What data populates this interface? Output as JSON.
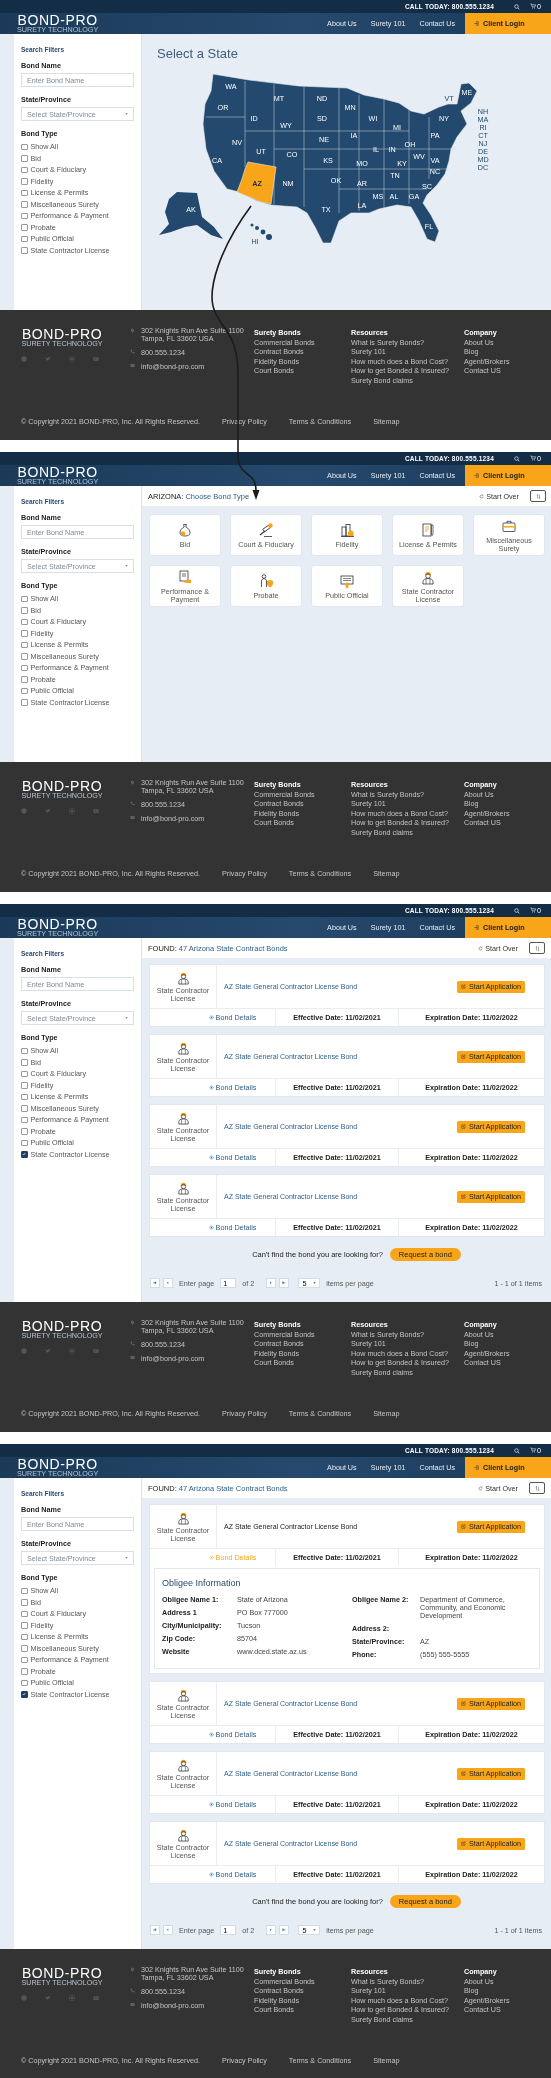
{
  "screens": [
    {
      "kind": "state_map",
      "header": {
        "phone": "CALL TODAY: 800.555.1234",
        "cart_count": "0",
        "logo": "BOND-PRO",
        "tagline": "SURETY TECHNOLOGY",
        "nav": [
          "About Us",
          "Surety 101",
          "Contact Us"
        ],
        "login": "Client Login"
      },
      "sidebar": {
        "title": "Search Filters",
        "bond_name": {
          "label": "Bond Name",
          "placeholder": "Enter Bond Name"
        },
        "state": {
          "label": "State/Province",
          "placeholder": "Select State/Province"
        },
        "bond_type": {
          "label": "Bond Type",
          "options": [
            {
              "label": "Show All",
              "checked": false
            },
            {
              "label": "Bid",
              "checked": false
            },
            {
              "label": "Court & Fiduciary",
              "checked": false
            },
            {
              "label": "Fidelity",
              "checked": false
            },
            {
              "label": "License & Permits",
              "checked": false
            },
            {
              "label": "Miscellaneous Surety",
              "checked": false
            },
            {
              "label": "Performance & Payment",
              "checked": false
            },
            {
              "label": "Probate",
              "checked": false
            },
            {
              "label": "Public Official",
              "checked": false
            },
            {
              "label": "State Contractor License",
              "checked": false
            }
          ]
        }
      },
      "main": {
        "title": "Select a State",
        "states": [
          {
            "abbr": "WA",
            "selected": false
          },
          {
            "abbr": "ME",
            "selected": false
          },
          {
            "abbr": "MT",
            "selected": false
          },
          {
            "abbr": "ND",
            "selected": false
          },
          {
            "abbr": "VT",
            "selected": false
          },
          {
            "abbr": "OR",
            "selected": false
          },
          {
            "abbr": "MN",
            "selected": false
          },
          {
            "abbr": "NH",
            "selected": false
          },
          {
            "abbr": "ID",
            "selected": false
          },
          {
            "abbr": "SD",
            "selected": false
          },
          {
            "abbr": "WI",
            "selected": false
          },
          {
            "abbr": "NY",
            "selected": false
          },
          {
            "abbr": "MA",
            "selected": false
          },
          {
            "abbr": "WY",
            "selected": false
          },
          {
            "abbr": "MI",
            "selected": false
          },
          {
            "abbr": "RI",
            "selected": false
          },
          {
            "abbr": "IA",
            "selected": false
          },
          {
            "abbr": "PA",
            "selected": false
          },
          {
            "abbr": "CT",
            "selected": false
          },
          {
            "abbr": "NE",
            "selected": false
          },
          {
            "abbr": "NV",
            "selected": false
          },
          {
            "abbr": "OH",
            "selected": false
          },
          {
            "abbr": "NJ",
            "selected": false
          },
          {
            "abbr": "IL",
            "selected": false
          },
          {
            "abbr": "IN",
            "selected": false
          },
          {
            "abbr": "UT",
            "selected": false
          },
          {
            "abbr": "DE",
            "selected": false
          },
          {
            "abbr": "CO",
            "selected": false
          },
          {
            "abbr": "WV",
            "selected": false
          },
          {
            "abbr": "CA",
            "selected": false
          },
          {
            "abbr": "KS",
            "selected": false
          },
          {
            "abbr": "VA",
            "selected": false
          },
          {
            "abbr": "MD",
            "selected": false
          },
          {
            "abbr": "MO",
            "selected": false
          },
          {
            "abbr": "KY",
            "selected": false
          },
          {
            "abbr": "DC",
            "selected": false
          },
          {
            "abbr": "NC",
            "selected": false
          },
          {
            "abbr": "TN",
            "selected": false
          },
          {
            "abbr": "OK",
            "selected": false
          },
          {
            "abbr": "AZ",
            "selected": true
          },
          {
            "abbr": "NM",
            "selected": false
          },
          {
            "abbr": "AR",
            "selected": false
          },
          {
            "abbr": "SC",
            "selected": false
          },
          {
            "abbr": "MS",
            "selected": false
          },
          {
            "abbr": "AL",
            "selected": false
          },
          {
            "abbr": "GA",
            "selected": false
          },
          {
            "abbr": "LA",
            "selected": false
          },
          {
            "abbr": "AK",
            "selected": false
          },
          {
            "abbr": "TX",
            "selected": false
          },
          {
            "abbr": "FL",
            "selected": false
          },
          {
            "abbr": "HI",
            "selected": false
          }
        ]
      },
      "footer": {
        "logo": "BOND-PRO",
        "tagline": "SURETY TECHNOLOGY",
        "address": [
          "302 Knights Run Ave Suite 1100",
          "Tampa, FL 33602 USA"
        ],
        "phone": "800.555.1234",
        "email": "info@bond-pro.com",
        "columns": [
          {
            "title": "Surety Bonds",
            "links": [
              "Commercial Bonds",
              "Contract Bonds",
              "Fidelity Bonds",
              "Court Bonds"
            ]
          },
          {
            "title": "Resources",
            "links": [
              "What is Surety Bonds?",
              "Surety 101",
              "How much does a Bond Cost?",
              "How to get Bonded & Insured?",
              "Surety Bond claims"
            ]
          },
          {
            "title": "Company",
            "links": [
              "About Us",
              "Blog",
              "Agent/Brokers",
              "Contact US"
            ]
          }
        ],
        "copyright": "© Copyright 2021 BOND-PRO, Inc. All Rights Reserved.",
        "links": [
          "Privacy Policy",
          "Terms & Conditions",
          "Sitemap"
        ]
      }
    },
    {
      "kind": "bond_types",
      "header": {
        "phone": "CALL TODAY: 800.555.1234",
        "cart_count": "0",
        "logo": "BOND-PRO",
        "tagline": "SURETY TECHNOLOGY",
        "nav": [
          "About Us",
          "Surety 101",
          "Contact Us"
        ],
        "login": "Client Login"
      },
      "sidebar": {
        "title": "Search Filters",
        "bond_name": {
          "label": "Bond Name",
          "placeholder": "Enter Bond Name"
        },
        "state": {
          "label": "State/Province",
          "placeholder": "Select State/Province"
        },
        "bond_type": {
          "label": "Bond Type",
          "options": [
            {
              "label": "Show All",
              "checked": false
            },
            {
              "label": "Bid",
              "checked": false
            },
            {
              "label": "Court & Fiduciary",
              "checked": false
            },
            {
              "label": "Fidelity",
              "checked": false
            },
            {
              "label": "License & Permits",
              "checked": false
            },
            {
              "label": "Miscellaneous Surety",
              "checked": false
            },
            {
              "label": "Performance & Payment",
              "checked": false
            },
            {
              "label": "Probate",
              "checked": false
            },
            {
              "label": "Public Official",
              "checked": false
            },
            {
              "label": "State Contractor License",
              "checked": false
            }
          ]
        }
      },
      "main": {
        "state": "ARIZONA:",
        "title": "Choose Bond Type",
        "start_over": "Start Over",
        "types": [
          "Bid",
          "Court & Fiduciary",
          "Fidelity",
          "License & Permits",
          "Miscellaneous Surety",
          "Performance & Payment",
          "Probate",
          "Public Official",
          "State Contractor License"
        ]
      },
      "footer": {
        "logo": "BOND-PRO",
        "tagline": "SURETY TECHNOLOGY",
        "address": [
          "302 Knights Run Ave Suite 1100",
          "Tampa, FL 33602 USA"
        ],
        "phone": "800.555.1234",
        "email": "info@bond-pro.com",
        "columns": [
          {
            "title": "Surety Bonds",
            "links": [
              "Commercial Bonds",
              "Contract Bonds",
              "Fidelity Bonds",
              "Court Bonds"
            ]
          },
          {
            "title": "Resources",
            "links": [
              "What is Surety Bonds?",
              "Surety 101",
              "How much does a Bond Cost?",
              "How to get Bonded & Insured?",
              "Surety Bond claims"
            ]
          },
          {
            "title": "Company",
            "links": [
              "About Us",
              "Blog",
              "Agent/Brokers",
              "Contact US"
            ]
          }
        ],
        "copyright": "© Copyright 2021 BOND-PRO, Inc. All Rights Reserved.",
        "links": [
          "Privacy Policy",
          "Terms & Conditions",
          "Sitemap"
        ]
      }
    },
    {
      "kind": "results",
      "header": {
        "phone": "CALL TODAY: 800.555.1234",
        "cart_count": "0",
        "logo": "BOND-PRO",
        "tagline": "SURETY TECHNOLOGY",
        "nav": [
          "About Us",
          "Surety 101",
          "Contact Us"
        ],
        "login": "Client Login"
      },
      "sidebar": {
        "title": "Search Filters",
        "bond_name": {
          "label": "Bond Name",
          "placeholder": "Enter Bond Name"
        },
        "state": {
          "label": "State/Province",
          "placeholder": "Select State/Province"
        },
        "bond_type": {
          "label": "Bond Type",
          "options": [
            {
              "label": "Show All",
              "checked": false
            },
            {
              "label": "Bid",
              "checked": false
            },
            {
              "label": "Court & Fiduciary",
              "checked": false
            },
            {
              "label": "Fidelity",
              "checked": false
            },
            {
              "label": "License & Permits",
              "checked": false
            },
            {
              "label": "Miscellaneous Surety",
              "checked": false
            },
            {
              "label": "Performance & Payment",
              "checked": false
            },
            {
              "label": "Probate",
              "checked": false
            },
            {
              "label": "Public Official",
              "checked": false
            },
            {
              "label": "State Contractor License",
              "checked": true
            }
          ]
        }
      },
      "main": {
        "found_label": "FOUND:",
        "found_text": "47 Arizona State Contract Bonds",
        "start_over": "Start Over",
        "results": [
          {
            "category": "State Contractor License",
            "title": "AZ State General Contractor License Bond",
            "action": "Start Application",
            "details": "Bond Details",
            "effective": "Effective Date: 11/02/2021",
            "expiration": "Expiration Date: 11/02/2022",
            "expanded": false
          },
          {
            "category": "State Contractor License",
            "title": "AZ State General Contractor License Bond",
            "action": "Start Application",
            "details": "Bond Details",
            "effective": "Effective Date: 11/02/2021",
            "expiration": "Expiration Date: 11/02/2022",
            "expanded": false
          },
          {
            "category": "State Contractor License",
            "title": "AZ State General Contractor License Bond",
            "action": "Start Application",
            "details": "Bond Details",
            "effective": "Effective Date: 11/02/2021",
            "expiration": "Expiration Date: 11/02/2022",
            "expanded": false
          },
          {
            "category": "State Contractor License",
            "title": "AZ State General Contractor License Bond",
            "action": "Start Application",
            "details": "Bond Details",
            "effective": "Effective Date: 11/02/2021",
            "expiration": "Expiration Date: 11/02/2022",
            "expanded": false
          }
        ],
        "request": {
          "text": "Can't find the bond you are looking for?",
          "button": "Request a bond"
        },
        "pagination": {
          "enter_page": "Enter page",
          "page": "1",
          "of": "of 2",
          "per_page": "5",
          "per_page_label": "items per page",
          "summary": "1 - 1 of 1 items"
        }
      },
      "footer": {
        "logo": "BOND-PRO",
        "tagline": "SURETY TECHNOLOGY",
        "address": [
          "302 Knights Run Ave Suite 1100",
          "Tampa, FL 33602 USA"
        ],
        "phone": "800.555.1234",
        "email": "info@bond-pro.com",
        "columns": [
          {
            "title": "Surety Bonds",
            "links": [
              "Commercial Bonds",
              "Contract Bonds",
              "Fidelity Bonds",
              "Court Bonds"
            ]
          },
          {
            "title": "Resources",
            "links": [
              "What is Surety Bonds?",
              "Surety 101",
              "How much does a Bond Cost?",
              "How to get Bonded & Insured?",
              "Surety Bond claims"
            ]
          },
          {
            "title": "Company",
            "links": [
              "About Us",
              "Blog",
              "Agent/Brokers",
              "Contact US"
            ]
          }
        ],
        "copyright": "© Copyright 2021 BOND-PRO, Inc. All Rights Reserved.",
        "links": [
          "Privacy Policy",
          "Terms & Conditions",
          "Sitemap"
        ]
      }
    },
    {
      "kind": "results",
      "header": {
        "phone": "CALL TODAY: 800.555.1234",
        "cart_count": "0",
        "logo": "BOND-PRO",
        "tagline": "SURETY TECHNOLOGY",
        "nav": [
          "About Us",
          "Surety 101",
          "Contact Us"
        ],
        "login": "Client Login"
      },
      "sidebar": {
        "title": "Search Filters",
        "bond_name": {
          "label": "Bond Name",
          "placeholder": "Enter Bond Name"
        },
        "state": {
          "label": "State/Province",
          "placeholder": "Select State/Province"
        },
        "bond_type": {
          "label": "Bond Type",
          "options": [
            {
              "label": "Show All",
              "checked": false
            },
            {
              "label": "Bid",
              "checked": false
            },
            {
              "label": "Court & Fiduciary",
              "checked": false
            },
            {
              "label": "Fidelity",
              "checked": false
            },
            {
              "label": "License & Permits",
              "checked": false
            },
            {
              "label": "Miscellaneous Surety",
              "checked": false
            },
            {
              "label": "Performance & Payment",
              "checked": false
            },
            {
              "label": "Probate",
              "checked": false
            },
            {
              "label": "Public Official",
              "checked": false
            },
            {
              "label": "State Contractor License",
              "checked": true
            }
          ]
        }
      },
      "main": {
        "found_label": "FOUND:",
        "found_text": "47 Arizona State Contract Bonds",
        "start_over": "Start Over",
        "results": [
          {
            "category": "State Contractor License",
            "title": "AZ State General Contractor License Bond",
            "action": "Start Application",
            "details": "Bond Details",
            "effective": "Effective Date: 11/02/2021",
            "expiration": "Expiration Date: 11/02/2022",
            "expanded": true,
            "obligee": {
              "title": "Obligee Information",
              "left": [
                {
                  "label": "Obligee Name 1:",
                  "value": "State of Arizona"
                },
                {
                  "label": "Address 1",
                  "value": "PO Box 777000"
                },
                {
                  "label": "City/Municipality:",
                  "value": "Tucson"
                },
                {
                  "label": "Zip Code:",
                  "value": "85704"
                },
                {
                  "label": "Website",
                  "value": "www.dced.state.az.us"
                }
              ],
              "right": [
                {
                  "label": "Obligee Name 2:",
                  "value": "Department of Commerce, Community, and Economic Development"
                },
                {
                  "label": "Address 2:"
                },
                {
                  "label": "State/Province:",
                  "value": "AZ"
                },
                {
                  "label": "Phone:",
                  "value": "(555) 555-5555"
                }
              ]
            }
          },
          {
            "category": "State Contractor License",
            "title": "AZ State General Contractor License Bond",
            "action": "Start Application",
            "details": "Bond Details",
            "effective": "Effective Date: 11/02/2021",
            "expiration": "Expiration Date: 11/02/2022",
            "expanded": false
          },
          {
            "category": "State Contractor License",
            "title": "AZ State General Contractor License Bond",
            "action": "Start Application",
            "details": "Bond Details",
            "effective": "Effective Date: 11/02/2021",
            "expiration": "Expiration Date: 11/02/2022",
            "expanded": false
          },
          {
            "category": "State Contractor License",
            "title": "AZ State General Contractor License Bond",
            "action": "Start Application",
            "details": "Bond Details",
            "effective": "Effective Date: 11/02/2021",
            "expiration": "Expiration Date: 11/02/2022",
            "expanded": false
          }
        ],
        "request": {
          "text": "Can't find the bond you are looking for?",
          "button": "Request a bond"
        },
        "pagination": {
          "enter_page": "Enter page",
          "page": "1",
          "of": "of 2",
          "per_page": "5",
          "per_page_label": "items per page",
          "summary": "1 - 1 of 1 items"
        }
      },
      "footer": {
        "logo": "BOND-PRO",
        "tagline": "SURETY TECHNOLOGY",
        "address": [
          "302 Knights Run Ave Suite 1100",
          "Tampa, FL 33602 USA"
        ],
        "phone": "800.555.1234",
        "email": "info@bond-pro.com",
        "columns": [
          {
            "title": "Surety Bonds",
            "links": [
              "Commercial Bonds",
              "Contract Bonds",
              "Fidelity Bonds",
              "Court Bonds"
            ]
          },
          {
            "title": "Resources",
            "links": [
              "What is Surety Bonds?",
              "Surety 101",
              "How much does a Bond Cost?",
              "How to get Bonded & Insured?",
              "Surety Bond claims"
            ]
          },
          {
            "title": "Company",
            "links": [
              "About Us",
              "Blog",
              "Agent/Brokers",
              "Contact US"
            ]
          }
        ],
        "copyright": "© Copyright 2021 BOND-PRO, Inc. All Rights Reserved.",
        "links": [
          "Privacy Policy",
          "Terms & Conditions",
          "Sitemap"
        ]
      }
    }
  ]
}
